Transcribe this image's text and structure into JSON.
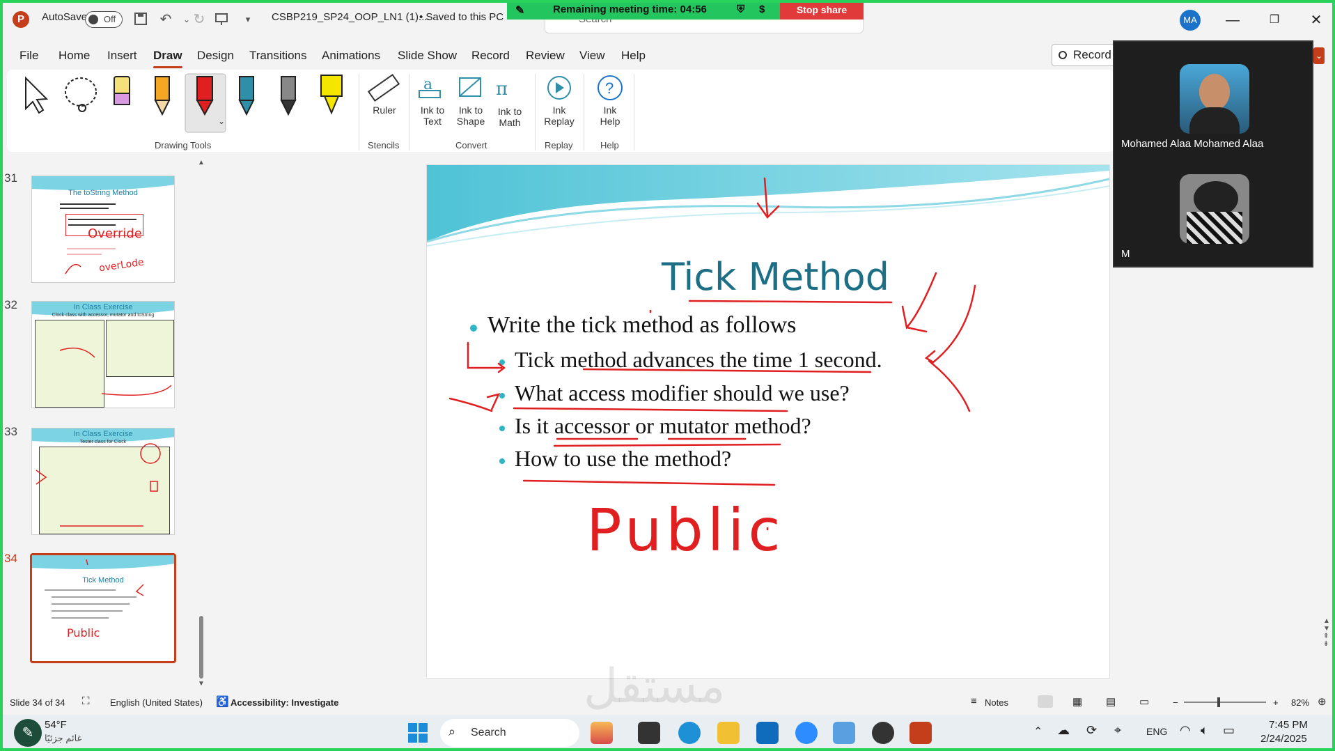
{
  "titlebar": {
    "autosave_label": "AutoSave",
    "autosave_state": "Off",
    "filename": "CSBP219_SP24_OOP_LN1 (1)....",
    "save_status": "• Saved to this PC",
    "search_placeholder": "Search",
    "user_initials": "MA"
  },
  "meeting": {
    "remaining_text": "Remaining meeting time: 04:56",
    "stop_share_label": "Stop share"
  },
  "menu": {
    "items": [
      "File",
      "Home",
      "Insert",
      "Draw",
      "Design",
      "Transitions",
      "Animations",
      "Slide Show",
      "Record",
      "Review",
      "View",
      "Help"
    ],
    "active": "Draw",
    "record_button": "Record"
  },
  "ribbon": {
    "ruler": "Ruler",
    "ink_to_text": [
      "Ink to",
      "Text"
    ],
    "ink_to_shape": [
      "Ink to",
      "Shape"
    ],
    "ink_to_math": [
      "Ink to",
      "Math"
    ],
    "ink_replay": [
      "Ink",
      "Replay"
    ],
    "ink_help": [
      "Ink",
      "Help"
    ],
    "groups": {
      "drawing_tools": "Drawing Tools",
      "stencils": "Stencils",
      "convert": "Convert",
      "replay": "Replay",
      "help": "Help"
    },
    "pen_colors": [
      "#f5e17a",
      "#f5a623",
      "#e02020",
      "#2f8fa8",
      "#333333",
      "#f5e600"
    ]
  },
  "thumbnails": [
    {
      "number": "31",
      "title": "The toString Method",
      "ink1": "Override",
      "ink2": "overLode"
    },
    {
      "number": "32",
      "title": "In Class Exercise",
      "subtitle": "Clock class with accessor, mutator and toString"
    },
    {
      "number": "33",
      "title": "In Class Exercise",
      "subtitle": "Tester class for Clock"
    },
    {
      "number": "34",
      "title": "Tick Method",
      "ink": "Public"
    }
  ],
  "slide": {
    "title": "Tick Method",
    "bullets": [
      {
        "level": 1,
        "text": "Write the tick method as follows"
      },
      {
        "level": 2,
        "text": "Tick method advances the time 1 second."
      },
      {
        "level": 2,
        "text": "What access modifier should we use?"
      },
      {
        "level": 2,
        "text": "Is it accessor or mutator method?"
      },
      {
        "level": 2,
        "text": "How to use the method?"
      }
    ],
    "handwriting": "Public"
  },
  "video": {
    "participant1": "Mohamed Alaa Mohamed Alaa",
    "participant2": "M"
  },
  "status": {
    "slide_count": "Slide 34 of 34",
    "language": "English (United States)",
    "accessibility": "Accessibility: Investigate",
    "notes": "Notes",
    "zoom": "82%"
  },
  "taskbar": {
    "weather_temp": "54°F",
    "weather_text": "غائم جزئيًا",
    "search": "Search",
    "lang": "ENG",
    "time": "7:45 PM",
    "date": "2/24/2025"
  },
  "watermark": "مستقل",
  "colors": {
    "accent": "#c43e1c",
    "meeting_green": "#22c55e",
    "ink_red": "#e02020",
    "title_teal": "#1d6f85"
  }
}
